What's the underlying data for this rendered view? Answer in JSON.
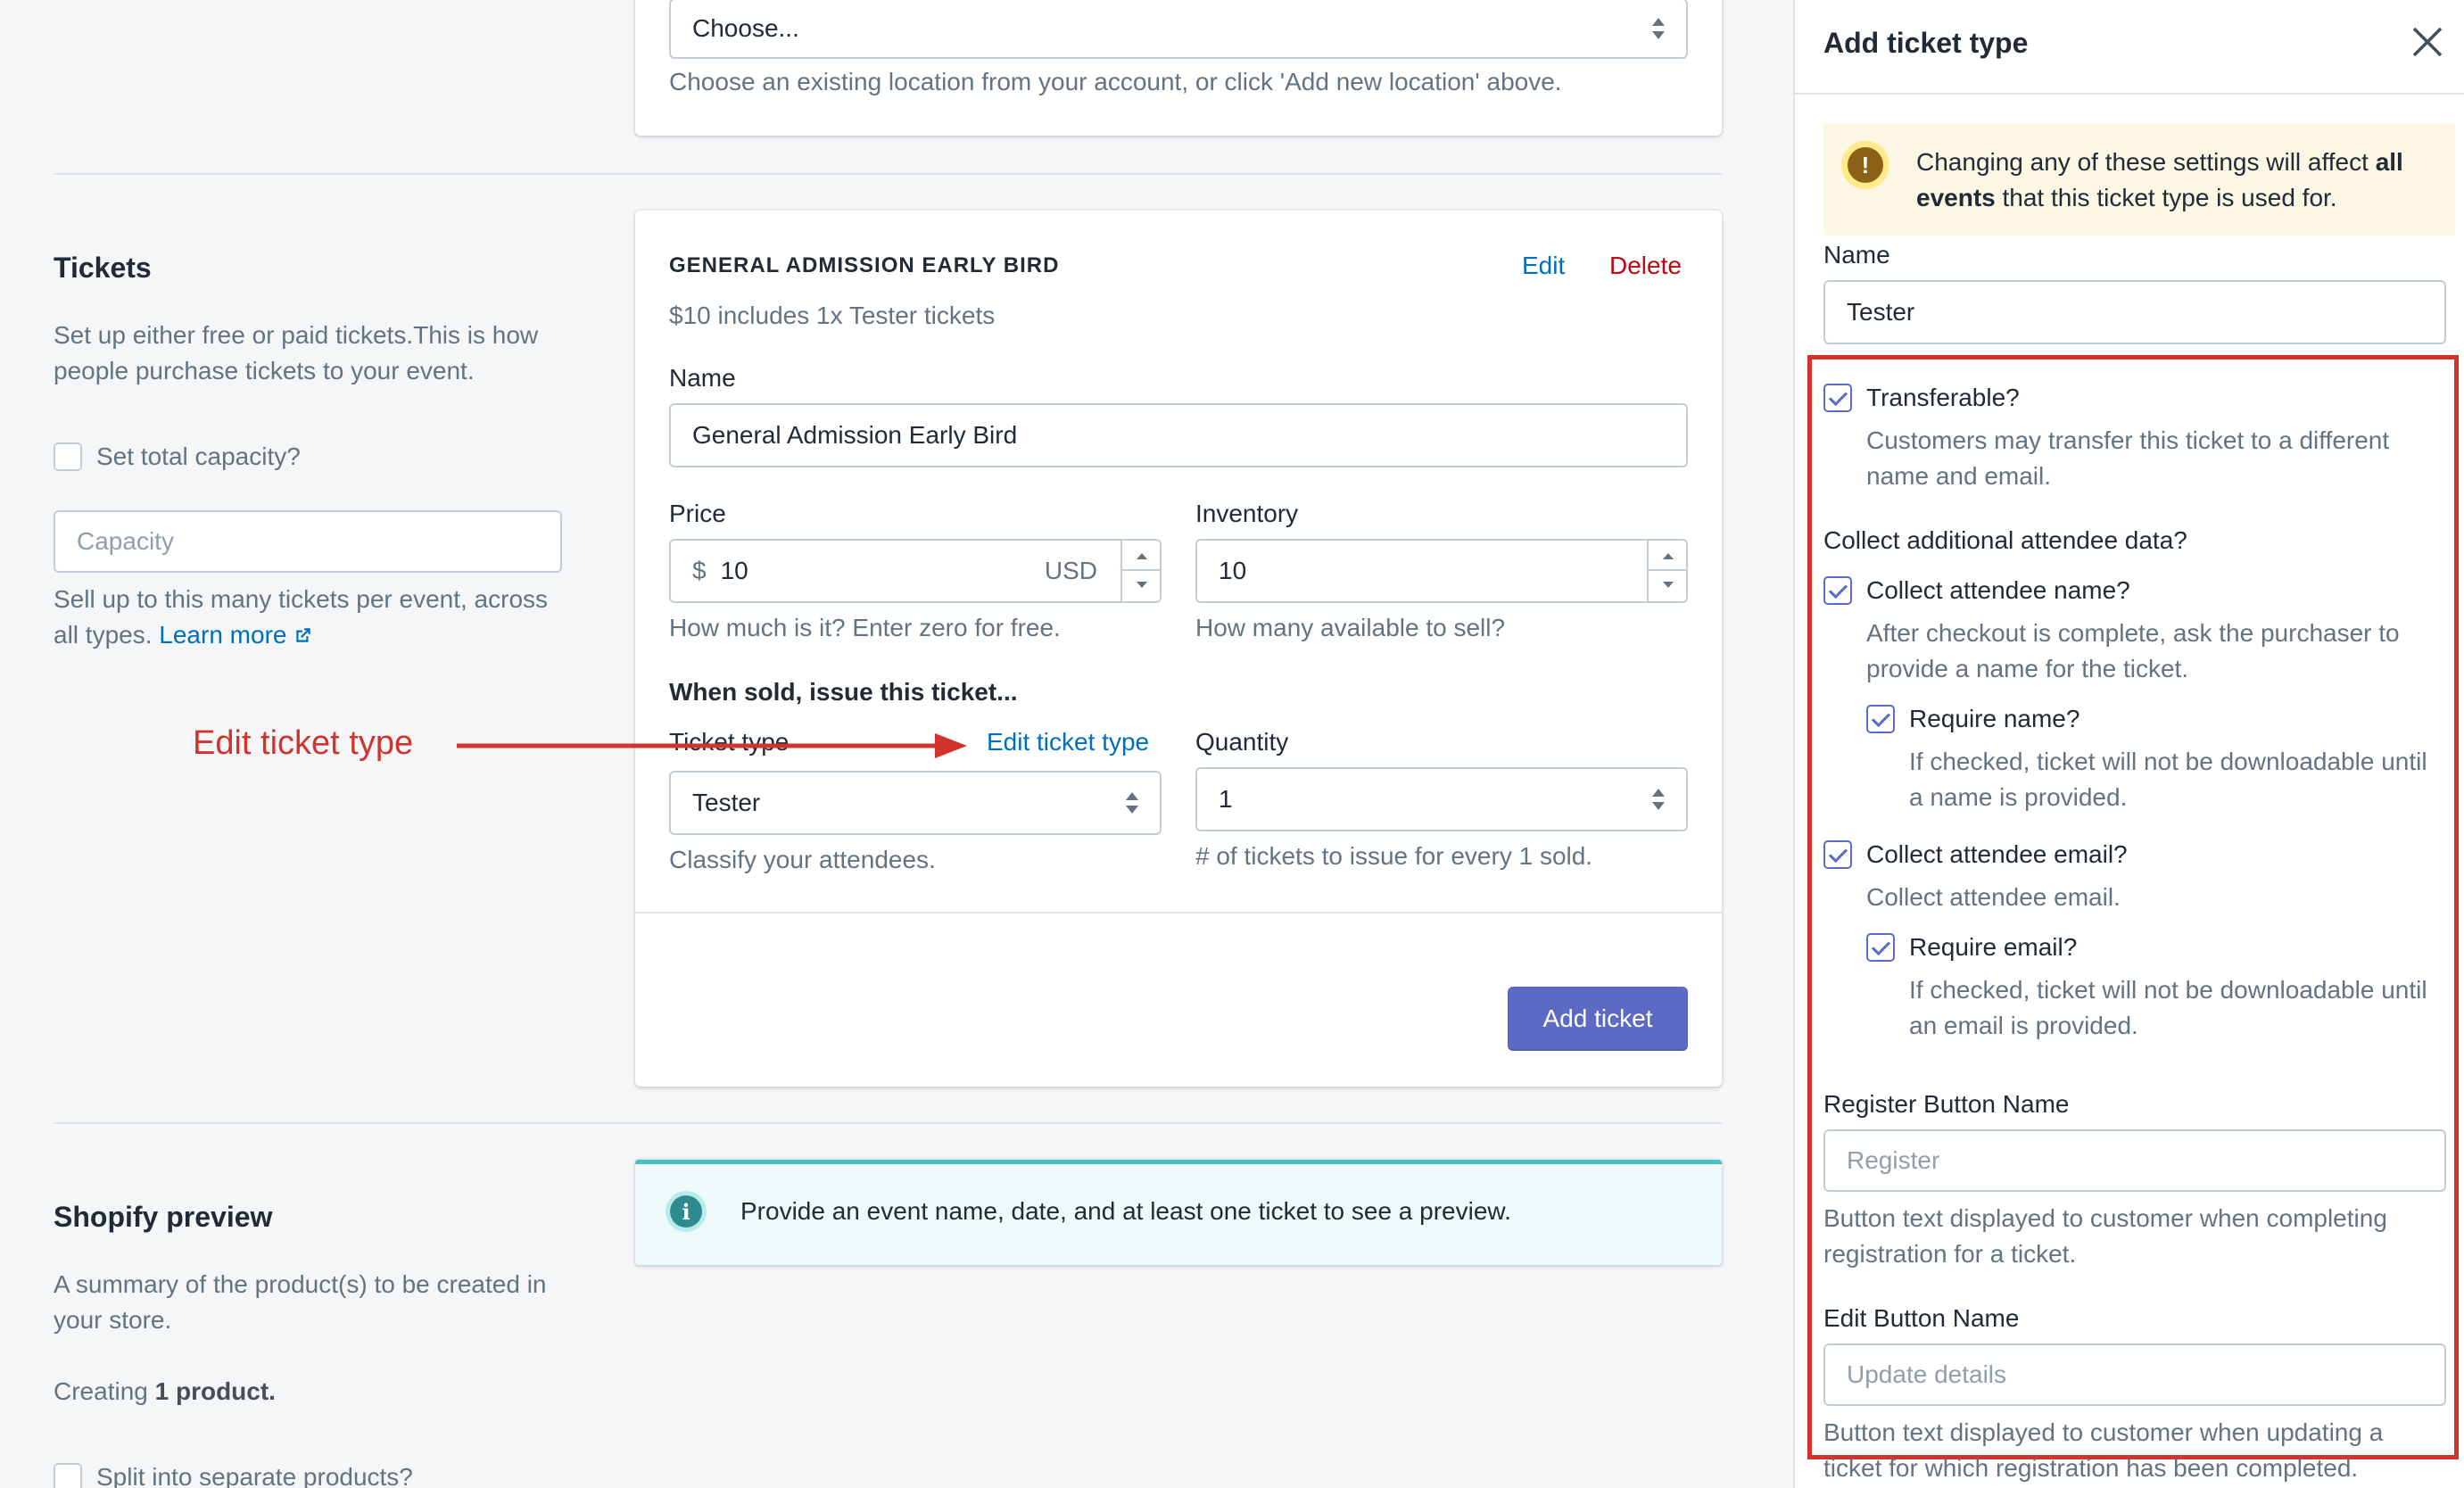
{
  "location": {
    "select_value": "Choose...",
    "help": "Choose an existing location from your account, or click 'Add new location' above."
  },
  "tickets_section": {
    "title": "Tickets",
    "description": "Set up either free or paid tickets.This is how people purchase tickets to your event.",
    "set_capacity_label": "Set total capacity?",
    "capacity_placeholder": "Capacity",
    "capacity_help": "Sell up to this many tickets per event, across all types.",
    "learn_more": "Learn more"
  },
  "ticket_card": {
    "heading": "GENERAL ADMISSION EARLY BIRD",
    "edit_label": "Edit",
    "delete_label": "Delete",
    "summary": "$10 includes 1x Tester tickets",
    "name_label": "Name",
    "name_value": "General Admission Early Bird",
    "price_label": "Price",
    "currency_symbol": "$",
    "price_value": "10",
    "currency_code": "USD",
    "price_help": "How much is it? Enter zero for free.",
    "inventory_label": "Inventory",
    "inventory_value": "10",
    "inventory_help": "How many available to sell?",
    "issue_heading": "When sold, issue this ticket...",
    "ticket_type_label": "Ticket type",
    "edit_ticket_type_link": "Edit ticket type",
    "ticket_type_value": "Tester",
    "ticket_type_help": "Classify your attendees.",
    "quantity_label": "Quantity",
    "quantity_value": "1",
    "quantity_help": "# of tickets to issue for every 1 sold.",
    "add_ticket_button": "Add ticket"
  },
  "annotation": {
    "label": "Edit ticket type",
    "color": "#d0342c"
  },
  "preview_section": {
    "title": "Shopify preview",
    "description": "A summary of the product(s) to be created in your store.",
    "creating_prefix": "Creating",
    "creating_count": "1 product.",
    "split_label": "Split into separate products?",
    "banner_text": "Provide an event name, date, and at least one ticket to see a preview."
  },
  "panel": {
    "title": "Add ticket type",
    "warning_text_prefix": "Changing any of these settings will affect",
    "warning_bold": "all events",
    "warning_text_suffix": "that this ticket type is used for.",
    "name_label": "Name",
    "name_value": "Tester",
    "transferable_label": "Transferable?",
    "transferable_help": "Customers may transfer this ticket to a different name and email.",
    "collect_heading": "Collect additional attendee data?",
    "collect_name_label": "Collect attendee name?",
    "collect_name_help": "After checkout is complete, ask the purchaser to provide a name for the ticket.",
    "require_name_label": "Require name?",
    "require_name_help": "If checked, ticket will not be downloadable until a name is provided.",
    "collect_email_label": "Collect attendee email?",
    "collect_email_help": "Collect attendee email.",
    "require_email_label": "Require email?",
    "require_email_help": "If checked, ticket will not be downloadable until an email is provided.",
    "register_label": "Register Button Name",
    "register_placeholder": "Register",
    "register_help": "Button text displayed to customer when completing registration for a ticket.",
    "edit_button_label": "Edit Button Name",
    "edit_button_placeholder": "Update details",
    "edit_button_help": "Button text displayed to customer when updating a ticket for which registration has been completed."
  },
  "colors": {
    "primary": "#5c6ac4",
    "link": "#006fbb",
    "danger": "#bf0711",
    "highlight_box": "#d0342c",
    "warning_bg": "#fcf6e4",
    "info_bg": "#eef9f9",
    "info_border": "#47c1bf"
  }
}
